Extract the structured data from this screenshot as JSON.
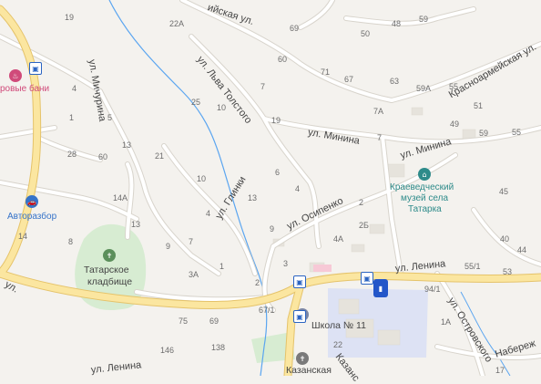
{
  "colors": {
    "land": "#f4f2ee",
    "park": "#d7ecd2",
    "water": "#5aa5f0",
    "major_road": "#fbe6a0",
    "major_road_edge": "#e5c36a",
    "minor_road": "#ffffff",
    "minor_road_edge": "#d8d4cc",
    "building": "#e9e6e0",
    "school_area": "#dde2f4",
    "poi_teal": "#2e8b8a",
    "poi_blue": "#3573c9",
    "poi_pink": "#d04a7a"
  },
  "streets": {
    "top_street_suffix": "ийская ул.",
    "lva_tolstogo": "ул. Льва Толстого",
    "minina_1": "ул. Минина",
    "minina_2": "ул. Минина",
    "krasnoarmeyskaya": "Красноармейская ул.",
    "michurina": "ул. Мичурина",
    "glinki": "ул. Глинки",
    "osipenko": "ул. Осипенко",
    "lenina": "ул. Ленина",
    "ostrovskogo": "ул. Островского",
    "naberezh": "Набереж",
    "left_ul": "ул.",
    "kazan_short": "Казанс",
    "lenina_bottom": "ул. Ленина"
  },
  "pois": {
    "bani": "ровые бани",
    "avtorazbor": "Авторазбор",
    "cemetery_line1": "Татарское",
    "cemetery_line2": "кладбище",
    "museum_line1": "Краеведческий",
    "museum_line2": "музей села",
    "museum_line3": "Татарка",
    "school": "Школа № 11",
    "kazan_church": "Казанская"
  },
  "house_numbers": {
    "n19a": "19",
    "n22a": "22А",
    "n69": "69",
    "n50": "50",
    "n48": "48",
    "n59": "59",
    "n60": "60",
    "n71": "71",
    "n67": "67",
    "n63": "63",
    "n59a": "59А",
    "n55": "55",
    "n4": "4",
    "n25": "25",
    "n10": "10",
    "n7": "7",
    "n7a": "7А",
    "n51": "51",
    "n1": "1",
    "n5": "5",
    "n19b": "19",
    "n28": "28",
    "n13a": "13",
    "n21": "21",
    "n6": "6",
    "n7b": "7",
    "n60b": "60",
    "n49": "49",
    "n55b": "55",
    "n59b": "59",
    "n10b": "10",
    "n4b": "4",
    "n2": "2",
    "n45": "45",
    "n14a": "14А",
    "n4c": "4",
    "n13b": "13",
    "n13c": "13",
    "n9a": "9",
    "n2b": "2Б",
    "n40": "40",
    "n14": "14",
    "n8": "8",
    "n9b": "9",
    "n7c": "7",
    "n4a": "4А",
    "n44": "44",
    "n3a": "3А",
    "n1b": "1",
    "n3": "3",
    "n551": "55/1",
    "n53": "53",
    "n2c": "2",
    "n941": "94/1",
    "n75": "75",
    "n69b": "69",
    "n671": "67/1",
    "n1a": "1А",
    "n22": "22",
    "n146": "146",
    "n138": "138",
    "n17": "17"
  }
}
